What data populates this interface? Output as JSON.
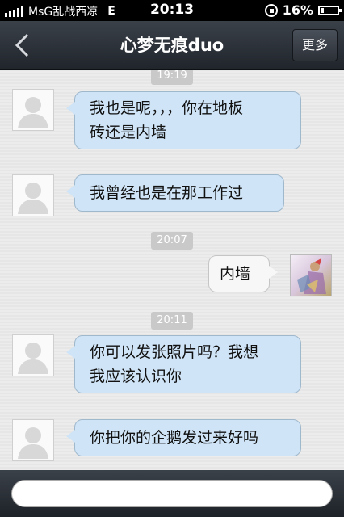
{
  "status_bar": {
    "carrier": "MsG乱战西凉",
    "network": "E",
    "time": "20:13",
    "battery": "16%"
  },
  "nav": {
    "title": "心梦无痕duo",
    "more_label": "更多"
  },
  "messages": [
    {
      "kind": "time",
      "text": "19:19"
    },
    {
      "kind": "incoming",
      "line1": "我也是呢，，，你在地板",
      "line2": "砖还是内墙"
    },
    {
      "kind": "incoming",
      "line1": "我曾经也是在那工作过"
    },
    {
      "kind": "time",
      "text": "20:07"
    },
    {
      "kind": "outgoing",
      "line1": "内墙"
    },
    {
      "kind": "time",
      "text": "20:11"
    },
    {
      "kind": "incoming",
      "line1": "你可以发张照片吗？我想",
      "line2": "我应该认识你"
    },
    {
      "kind": "incoming",
      "line1": "你把你的企鹅发过来好吗"
    }
  ],
  "colors": {
    "incoming_bubble": "#cfe4f6",
    "outgoing_bubble": "#f7f7f7",
    "bar": "#2b3037"
  }
}
